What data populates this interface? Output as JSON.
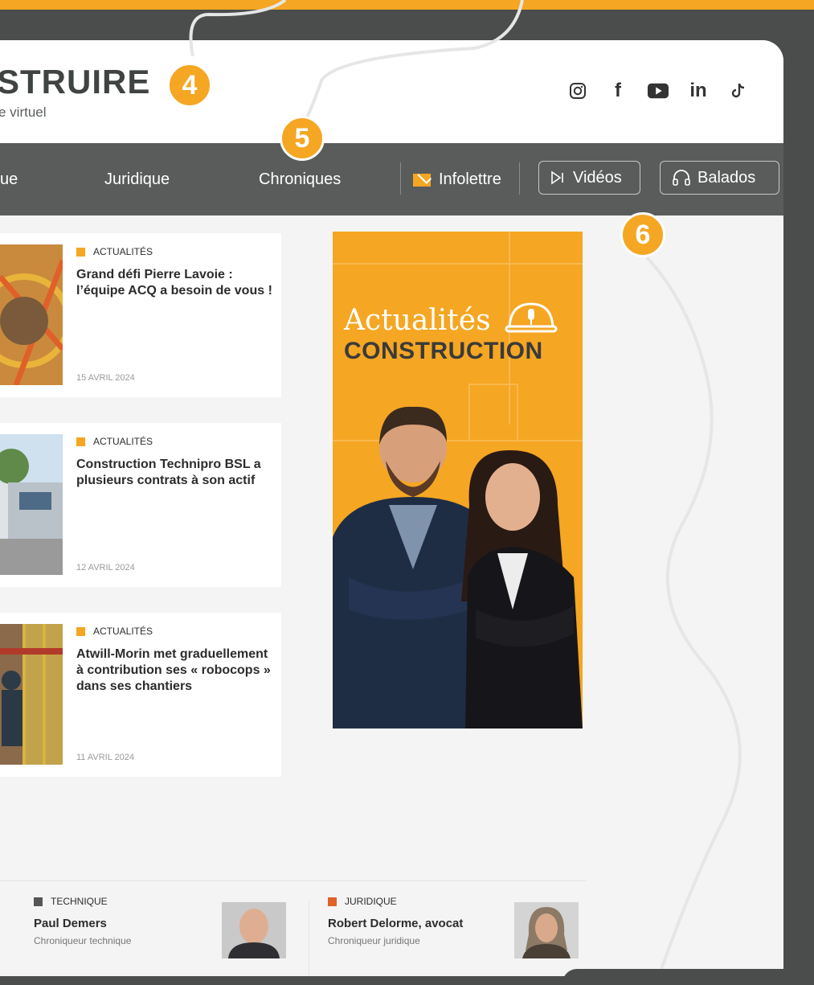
{
  "header": {
    "logo": "STRUIRE",
    "tagline": "e virtuel",
    "socials": [
      "instagram-icon",
      "facebook-icon",
      "youtube-icon",
      "linkedin-icon",
      "tiktok-icon"
    ]
  },
  "nav": {
    "item_partial": "ue",
    "juridique": "Juridique",
    "chroniques": "Chroniques",
    "infolettre": "Infolettre",
    "videos": "Vidéos",
    "balados": "Balados"
  },
  "articles": [
    {
      "tag": "ACTUALITÉS",
      "title": "Grand défi Pierre Lavoie : l’équipe ACQ a besoin de vous !",
      "date": "15 AVRIL 2024"
    },
    {
      "tag": "ACTUALITÉS",
      "title": "Construction Technipro BSL a plusieurs contrats à son actif",
      "date": "12 AVRIL 2024"
    },
    {
      "tag": "ACTUALITÉS",
      "title": "Atwill-Morin met graduellement à contribution ses « robocops » dans ses chantiers",
      "date": "11 AVRIL 2024"
    }
  ],
  "ad": {
    "subtitle": "Actualités",
    "title": "CONSTRUCTION"
  },
  "chroniqueurs": [
    {
      "tag": "TECHNIQUE",
      "name": "Paul Demers",
      "role": "Chroniqueur technique",
      "tag_color": "#555555"
    },
    {
      "tag": "JURIDIQUE",
      "name": "Robert Delorme, avocat",
      "role": "Chroniqueur juridique",
      "tag_color": "#e0612a"
    }
  ],
  "badges": [
    "4",
    "5",
    "6"
  ],
  "colors": {
    "accent": "#f5a623",
    "nav": "#595c5b",
    "frame": "#4a4d4b"
  }
}
